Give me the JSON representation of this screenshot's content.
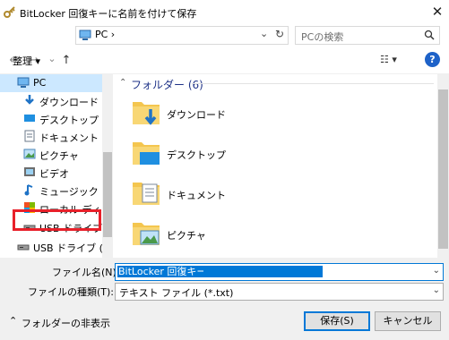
{
  "window": {
    "title": "BitLocker 回復キーに名前を付けて保存",
    "close_glyph": "✕"
  },
  "nav": {
    "back_glyph": "←",
    "forward_glyph": "→",
    "dropdown_glyph": "⌄",
    "up_glyph": "↑",
    "refresh_glyph": "↻",
    "address": "PC  ›",
    "search_placeholder": "PCの検索"
  },
  "toolbar": {
    "organize_label": "整理 ▾",
    "view_glyph": "☷ ▾",
    "help_glyph": "?"
  },
  "sidebar": {
    "items": [
      {
        "label": "PC",
        "icon": "pc-icon"
      },
      {
        "label": "ダウンロード",
        "icon": "download-icon"
      },
      {
        "label": "デスクトップ",
        "icon": "desktop-icon"
      },
      {
        "label": "ドキュメント",
        "icon": "documents-icon"
      },
      {
        "label": "ピクチャ",
        "icon": "pictures-icon"
      },
      {
        "label": "ビデオ",
        "icon": "videos-icon"
      },
      {
        "label": "ミュージック",
        "icon": "music-icon"
      },
      {
        "label": "ローカル ディスク (C",
        "icon": "local-disk-icon"
      },
      {
        "label": "USB ドライブ (D:)",
        "icon": "usb-drive-icon"
      },
      {
        "label": "USB ドライブ (D:)",
        "icon": "usb-drive-icon"
      }
    ]
  },
  "content": {
    "group_title": "フォルダー (6)",
    "folders": [
      {
        "label": "ダウンロード",
        "icon": "download-folder-icon"
      },
      {
        "label": "デスクトップ",
        "icon": "desktop-folder-icon"
      },
      {
        "label": "ドキュメント",
        "icon": "documents-folder-icon"
      },
      {
        "label": "ピクチャ",
        "icon": "pictures-folder-icon"
      }
    ]
  },
  "form": {
    "filename_label": "ファイル名(N):",
    "filename_value": "BitLocker 回復キー",
    "filetype_label": "ファイルの種類(T):",
    "filetype_value": "テキスト ファイル (*.txt)",
    "dropdown_glyph": "⌄"
  },
  "footer": {
    "hide_folders_label": "フォルダーの非表示",
    "hide_glyph": "⌃",
    "save_label": "保存(S)",
    "cancel_label": "キャンセル"
  },
  "colors": {
    "accent": "#0078d7",
    "highlight_box": "#e8202a",
    "group_heading": "#1e3287",
    "folder": "#f4c64f"
  }
}
